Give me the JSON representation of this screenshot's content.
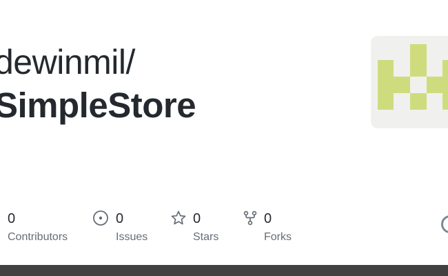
{
  "repo": {
    "owner": "dewinmil/",
    "name": "SimpleStore"
  },
  "stats": {
    "contributors": {
      "count": "0",
      "label": "Contributors"
    },
    "issues": {
      "count": "0",
      "label": "Issues",
      "icon": "issue-opened-icon"
    },
    "stars": {
      "count": "0",
      "label": "Stars",
      "icon": "star-icon"
    },
    "forks": {
      "count": "0",
      "label": "Forks",
      "icon": "repo-forked-icon"
    }
  },
  "colors": {
    "avatar_fg": "#cfdc7e",
    "avatar_bg": "#f0f1ef",
    "icon": "#656d76",
    "footer": "#414141"
  }
}
